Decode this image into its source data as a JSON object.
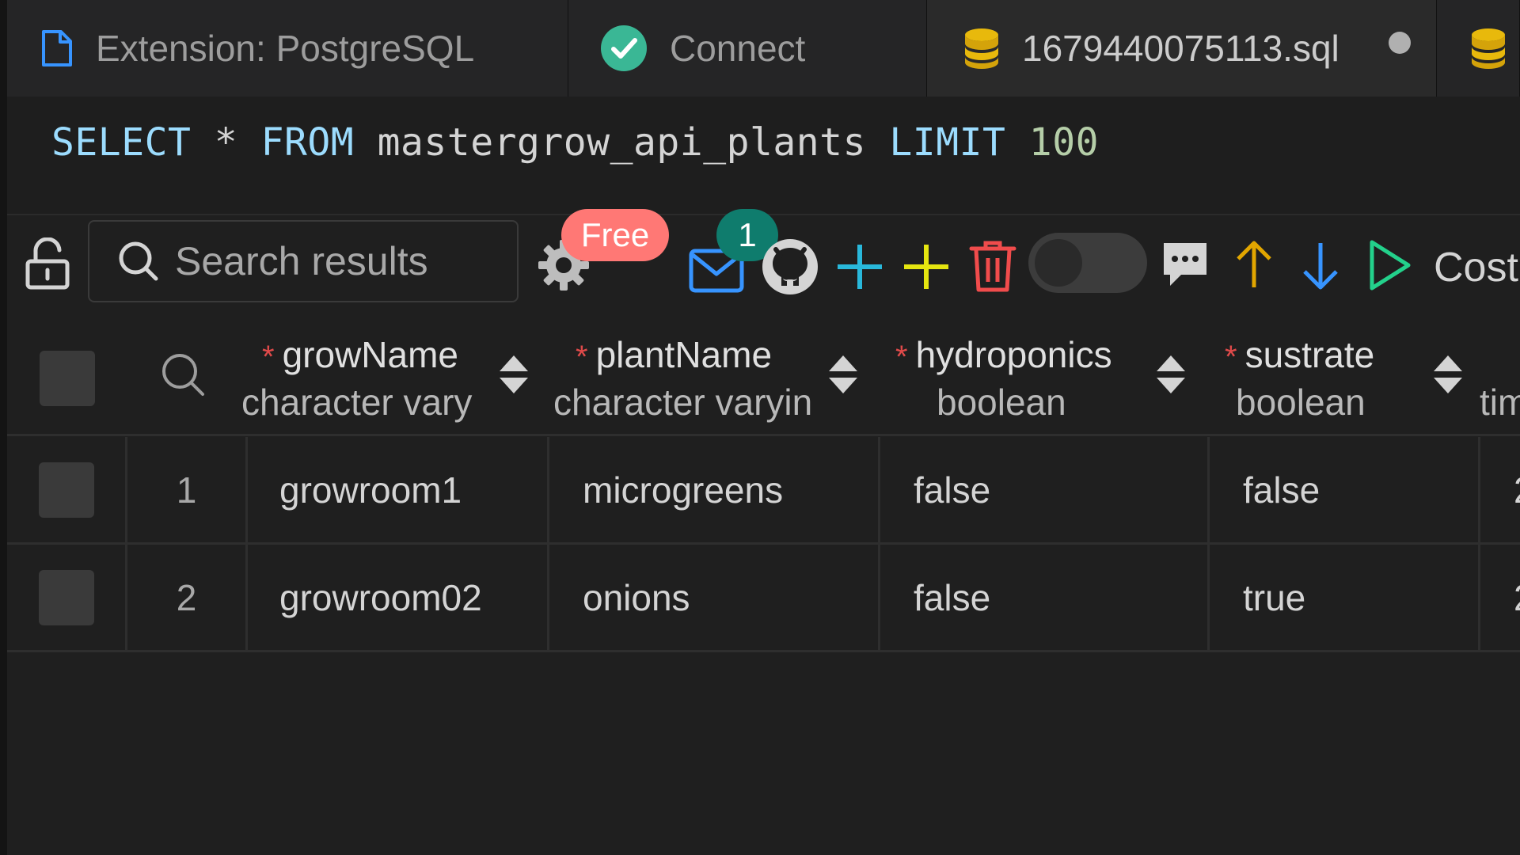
{
  "tabs": [
    {
      "label": "Extension: PostgreSQL",
      "icon": "file-icon"
    },
    {
      "label": "Connect",
      "icon": "check-circle-icon"
    },
    {
      "label": "1679440075113.sql",
      "icon": "database-icon",
      "dirty": true
    },
    {
      "label": "",
      "icon": "database-icon"
    }
  ],
  "editor": {
    "select": "SELECT",
    "star": "*",
    "from": "FROM",
    "table": "mastergrow_api_plants",
    "limit": "LIMIT",
    "count": "100"
  },
  "toolbar": {
    "search_placeholder": "Search results",
    "free_badge": "Free",
    "notification_count": "1",
    "cost_label": "Cost"
  },
  "columns": [
    {
      "name": "growName",
      "type": "character vary",
      "required": "*"
    },
    {
      "name": "plantName",
      "type": "character varyin",
      "required": "*"
    },
    {
      "name": "hydroponics",
      "type": "boolean",
      "required": "*"
    },
    {
      "name": "sustrate",
      "type": "boolean",
      "required": "*"
    },
    {
      "name": "",
      "type": "tim",
      "required": ""
    }
  ],
  "rows": [
    {
      "num": "1",
      "growName": "growroom1",
      "plantName": "microgreens",
      "hydroponics": "false",
      "sustrate": "false",
      "next": "2"
    },
    {
      "num": "2",
      "growName": "growroom02",
      "plantName": "onions",
      "hydroponics": "false",
      "sustrate": "true",
      "next": "2"
    }
  ],
  "colors": {
    "accent_blue": "#3794ff",
    "success_green": "#3ab795",
    "add_cyan": "#29b8db",
    "add_yellow": "#e5e510",
    "delete_red": "#f14c4c",
    "arrow_orange": "#e2a600",
    "run_green": "#23d18b"
  }
}
